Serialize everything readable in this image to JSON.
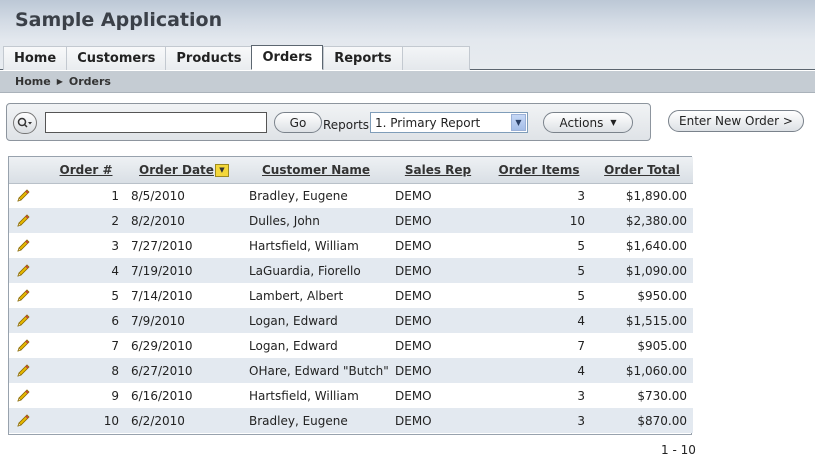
{
  "app": {
    "title": "Sample Application"
  },
  "tabs": [
    {
      "label": "Home"
    },
    {
      "label": "Customers"
    },
    {
      "label": "Products"
    },
    {
      "label": "Orders"
    },
    {
      "label": "Reports"
    }
  ],
  "breadcrumb": {
    "items": [
      "Home",
      "Orders"
    ]
  },
  "search": {
    "value": "",
    "go_label": "Go",
    "reports_label": "Reports",
    "selected_report": "1. Primary Report",
    "actions_label": "Actions",
    "new_order_label": "Enter New Order >"
  },
  "table": {
    "columns": [
      "Order #",
      "Order Date",
      "Customer Name",
      "Sales Rep",
      "Order Items",
      "Order Total"
    ],
    "rows": [
      [
        "1",
        "8/5/2010",
        "Bradley, Eugene",
        "DEMO",
        "3",
        "$1,890.00"
      ],
      [
        "2",
        "8/2/2010",
        "Dulles, John",
        "DEMO",
        "10",
        "$2,380.00"
      ],
      [
        "3",
        "7/27/2010",
        "Hartsfield, William",
        "DEMO",
        "5",
        "$1,640.00"
      ],
      [
        "4",
        "7/19/2010",
        "LaGuardia, Fiorello",
        "DEMO",
        "5",
        "$1,090.00"
      ],
      [
        "5",
        "7/14/2010",
        "Lambert, Albert",
        "DEMO",
        "5",
        "$950.00"
      ],
      [
        "6",
        "7/9/2010",
        "Logan, Edward",
        "DEMO",
        "4",
        "$1,515.00"
      ],
      [
        "7",
        "6/29/2010",
        "Logan, Edward",
        "DEMO",
        "7",
        "$905.00"
      ],
      [
        "8",
        "6/27/2010",
        "OHare, Edward \"Butch\"",
        "DEMO",
        "4",
        "$1,060.00"
      ],
      [
        "9",
        "6/16/2010",
        "Hartsfield, William",
        "DEMO",
        "3",
        "$730.00"
      ],
      [
        "10",
        "6/2/2010",
        "Bradley, Eugene",
        "DEMO",
        "3",
        "$870.00"
      ]
    ]
  },
  "pagination": {
    "label": "1 - 10"
  },
  "colors": {
    "row_even": "#e3e9f0",
    "row_odd": "#ffffff",
    "sort_indicator": "#f4d73a",
    "edit_pencil": "#e8b800"
  },
  "icons": {
    "row_edit": "pencil-icon",
    "search": "search-icon",
    "sort": "sort-descending-icon"
  }
}
